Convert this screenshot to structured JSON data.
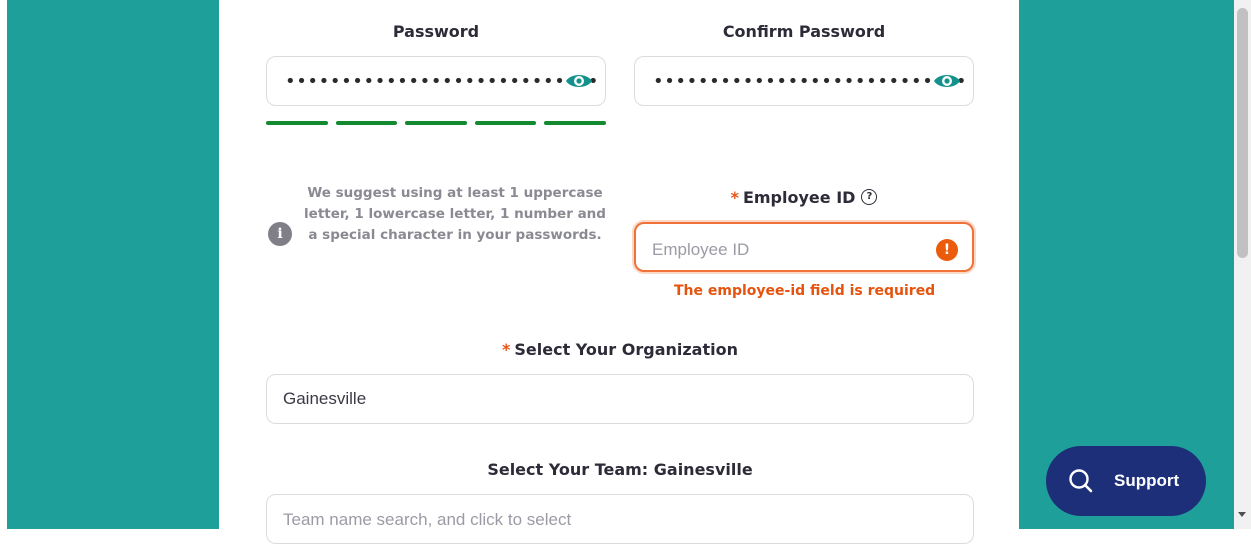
{
  "password": {
    "label": "Password",
    "masked_value": "••••••••••••••••••••••••••••",
    "toggle_icon": "eye-icon",
    "strength_segments_filled": 5,
    "strength_segments_total": 5,
    "strength_color": "#138a2f"
  },
  "confirm_password": {
    "label": "Confirm Password",
    "masked_value": "••••••••••••••••••••••••••••",
    "toggle_icon": "eye-icon"
  },
  "password_hint": {
    "icon": "info-icon",
    "text": "We suggest using at least 1 uppercase letter, 1 lowercase letter, 1 number and a special character in your passwords."
  },
  "employee_id": {
    "required_mark": "*",
    "label": "Employee ID",
    "help_icon": "question-circle-icon",
    "placeholder": "Employee ID",
    "value": "",
    "error_icon": "exclamation-icon",
    "error_message": "The employee-id field is required",
    "error_color": "#e6530e"
  },
  "organization": {
    "required_mark": "*",
    "label": "Select Your Organization",
    "value": "Gainesville"
  },
  "team": {
    "label": "Select Your Team: Gainesville",
    "placeholder": "Team name search, and click to select"
  },
  "support_button": {
    "icon": "search-icon",
    "label": "Support",
    "color": "#1e2f79"
  },
  "theme": {
    "background": "#1f9f9a",
    "accent": "#ea5b0c"
  }
}
